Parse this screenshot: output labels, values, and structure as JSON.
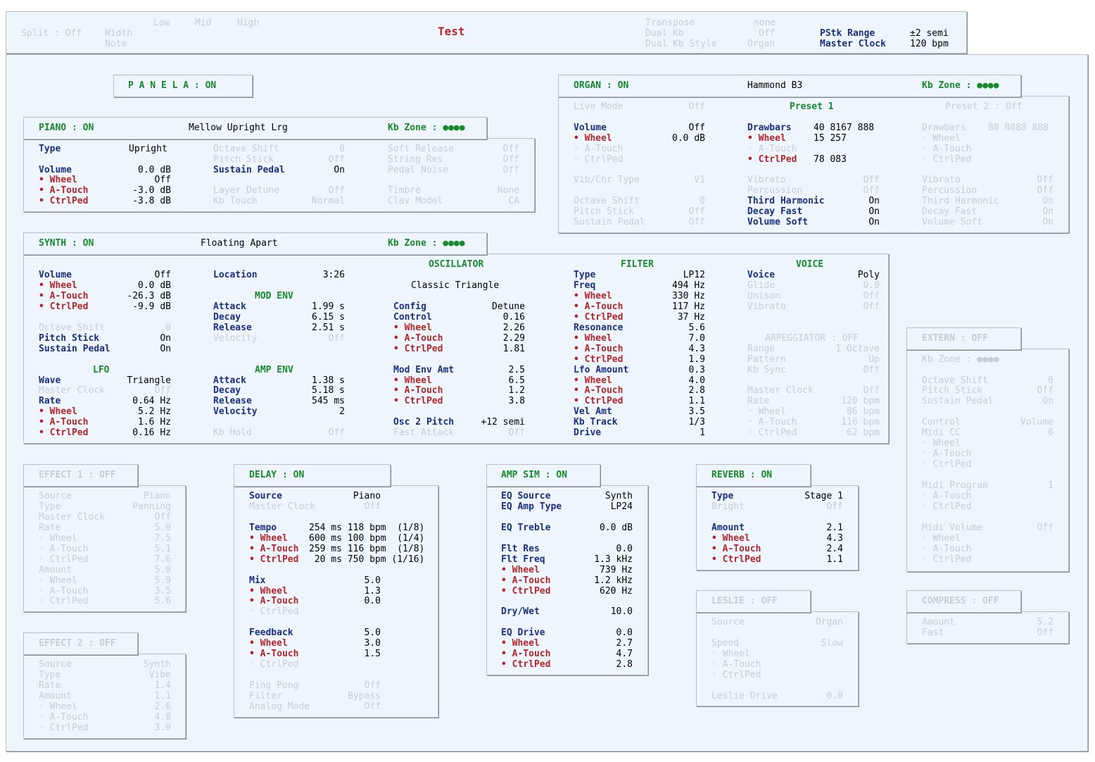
{
  "header": {
    "split": "Split : Off",
    "width_label": "Width",
    "note_label": "Note",
    "low": "Low",
    "mid": "Mid",
    "high": "High",
    "title": "Test",
    "transpose_label": "Transpose",
    "transpose_value": "none",
    "dual_kb_label": "Dual Kb",
    "dual_kb_value": "Off",
    "dual_kb_style_label": "Dual Kb Style",
    "dual_kb_style_value": "Organ",
    "pstk_label": "PStk Range",
    "pstk_value": "±2 semi",
    "master_clock_label": "Master Clock",
    "master_clock_value": "120 bpm"
  },
  "panel_a": "P A N E L  A : ON",
  "piano": {
    "tab": "PIANO : ON",
    "preset": "Mellow Upright Lrg",
    "kbzone": "Kb Zone : ●●●●",
    "type_l": "Type",
    "type_v": "Upright",
    "vol_l": "Volume",
    "vol_v": "0.0 dB",
    "wheel_l": "• Wheel",
    "wheel_v": "Off",
    "at_l": "• A-Touch",
    "at_v": "-3.0 dB",
    "cp_l": "• CtrlPed",
    "cp_v": "-3.8 dB",
    "oct_l": "Octave Shift",
    "oct_v": "0",
    "ps_l": "Pitch Stick",
    "ps_v": "Off",
    "sp_l": "Sustain Pedal",
    "sp_v": "On",
    "ld_l": "Layer Detune",
    "ld_v": "Off",
    "kt_l": "Kb Touch",
    "kt_v": "Normal",
    "sr_l": "Soft Release",
    "sr_v": "Off",
    "str_l": "String Res",
    "str_v": "Off",
    "pn_l": "Pedal Noise",
    "pn_v": "Off",
    "tim_l": "Timbre",
    "tim_v": "None",
    "clav_l": "Clav Model",
    "clav_v": "CA"
  },
  "organ": {
    "tab": "ORGAN : ON",
    "preset": "Hammond B3",
    "kbzone": "Kb Zone : ●●●●",
    "live_l": "Live Mode",
    "live_v": "Off",
    "preset1": "Preset 1",
    "preset2": "Preset 2 : Off",
    "vol_l": "Volume",
    "vol_v": "Off",
    "wheel_l": "• Wheel",
    "wheel_v": "0.0 dB",
    "at_l": "◦ A-Touch",
    "cp_l": "◦ CtrlPed",
    "vib_l": "Vib/Chr Type",
    "vib_v": "V1",
    "oct_l": "Octave Shift",
    "oct_v": "0",
    "ps_l": "Pitch Stick",
    "ps_v": "Off",
    "sp_l": "Sustain Pedal",
    "sp_v": "Off",
    "p1": {
      "db_l": "Drawbars",
      "db_v": "40 8167 888",
      "wheel_l": "• Wheel",
      "wheel_v": "15 257",
      "at_l": "◦ A-Touch",
      "cp_l": "• CtrlPed",
      "cp_v": "78 083",
      "vibrato_l": "Vibrato",
      "vibrato_v": "Off",
      "perc_l": "Percussion",
      "perc_v": "Off",
      "th_l": "Third Harmonic",
      "th_v": "On",
      "df_l": "Decay Fast",
      "df_v": "On",
      "vs_l": "Volume Soft",
      "vs_v": "On"
    },
    "p2": {
      "db_l": "Drawbars",
      "db_v": "88 8888 888",
      "wheel_l": "◦ Wheel",
      "at_l": "◦ A-Touch",
      "cp_l": "◦ CtrlPed",
      "vibrato_l": "Vibrato",
      "vibrato_v": "Off",
      "perc_l": "Percussion",
      "perc_v": "Off",
      "th_l": "Third Harmonic",
      "th_v": "On",
      "df_l": "Decay Fast",
      "df_v": "On",
      "vs_l": "Volume Soft",
      "vs_v": "On"
    }
  },
  "synth": {
    "tab": "SYNTH : ON",
    "preset": "Floating Apart",
    "kbzone": "Kb Zone : ●●●●",
    "vol_l": "Volume",
    "vol_v": "Off",
    "wheel_l": "• Wheel",
    "wheel_v": "0.0 dB",
    "at_l": "• A-Touch",
    "at_v": "-26.3 dB",
    "cp_l": "• CtrlPed",
    "cp_v": "-9.9 dB",
    "oct_l": "Octave Shift",
    "oct_v": "0",
    "ps_l": "Pitch Stick",
    "ps_v": "On",
    "sp_l": "Sustain Pedal",
    "sp_v": "On",
    "lfo_h": "LFO",
    "wave_l": "Wave",
    "wave_v": "Triangle",
    "mc_l": "Master Clock",
    "mc_v": "Off",
    "rate_l": "Rate",
    "rate_v": "0.64 Hz",
    "lw_l": "• Wheel",
    "lw_v": "5.2 Hz",
    "la_l": "• A-Touch",
    "la_v": "1.6 Hz",
    "lc_l": "• CtrlPed",
    "lc_v": "0.16 Hz",
    "loc_l": "Location",
    "loc_v": "3:26",
    "modenv_h": "MOD ENV",
    "ma_l": "Attack",
    "ma_v": "1.99 s",
    "md_l": "Decay",
    "md_v": "6.15 s",
    "mr_l": "Release",
    "mr_v": "2.51 s",
    "mv_l": "Velocity",
    "mv_v": "Off",
    "ampenv_h": "AMP ENV",
    "aa_l": "Attack",
    "aa_v": "1.38 s",
    "ad_l": "Decay",
    "ad_v": "5.18 s",
    "ar_l": "Release",
    "ar_v": "545 ms",
    "av_l": "Velocity",
    "av_v": "2",
    "kh_l": "Kb Hold",
    "kh_v": "Off",
    "osc_h": "OSCILLATOR",
    "osc_name": "Classic Triangle",
    "cfg_l": "Config",
    "cfg_v": "Detune",
    "ctl_l": "Control",
    "ctl_v": "0.16",
    "ow_l": "• Wheel",
    "ow_v": "2.26",
    "oa_l": "• A-Touch",
    "oa_v": "2.29",
    "oc_l": "• CtrlPed",
    "oc_v": "1.81",
    "mea_l": "Mod Env Amt",
    "mea_v": "2.5",
    "mew_l": "• Wheel",
    "mew_v": "6.5",
    "mea2_l": "• A-Touch",
    "mea2_v": "1.2",
    "mec_l": "• CtrlPed",
    "mec_v": "3.8",
    "o2p_l": "Osc 2 Pitch",
    "o2p_v": "+12 semi",
    "fa_l": "Fast Attack",
    "fa_v": "Off",
    "filt_h": "FILTER",
    "ft_l": "Type",
    "ft_v": "LP12",
    "ff_l": "Freq",
    "ff_v": "494 Hz",
    "ffw_l": "• Wheel",
    "ffw_v": "330 Hz",
    "ffa_l": "• A-Touch",
    "ffa_v": "117 Hz",
    "ffc_l": "• CtrlPed",
    "ffc_v": "37 Hz",
    "res_l": "Resonance",
    "res_v": "5.6",
    "rw_l": "• Wheel",
    "rw_v": "7.0",
    "ra_l": "• A-Touch",
    "ra_v": "4.3",
    "rc_l": "• CtrlPed",
    "rc_v": "1.9",
    "la2_l": "Lfo Amount",
    "la2_v": "0.3",
    "lfw_l": "• Wheel",
    "lfw_v": "4.0",
    "lfa_l": "• A-Touch",
    "lfa_v": "2.8",
    "lfc_l": "• CtrlPed",
    "lfc_v": "1.1",
    "vel_l": "Vel Amt",
    "vel_v": "3.5",
    "kbt_l": "Kb Track",
    "kbt_v": "1/3",
    "drv_l": "Drive",
    "drv_v": "1",
    "voice_h": "VOICE",
    "vo_l": "Voice",
    "vo_v": "Poly",
    "gl_l": "Glide",
    "gl_v": "0.0",
    "un_l": "Unison",
    "un_v": "Off",
    "vb_l": "Vibrato",
    "vb_v": "Off",
    "arp_h": "ARPEGGIATOR : OFF",
    "rg_l": "Range",
    "rg_v": "1 Octave",
    "pt_l": "Pattern",
    "pt_v": "Up",
    "ks_l": "Kb Sync",
    "ks_v": "Off",
    "amc_l": "Master Clock",
    "amc_v": "Off",
    "art_l": "Rate",
    "art_v": "120 bpm",
    "arw_l": "◦ Wheel",
    "arw_v": "86 bpm",
    "ara_l": "◦ A-Touch",
    "ara_v": "116 bpm",
    "arc_l": "◦ CtrlPed",
    "arc_v": "62 bpm"
  },
  "extern": {
    "tab": "EXTERN : OFF",
    "kbzone": "Kb Zone : ●●●●",
    "oct_l": "Octave Shift",
    "oct_v": "0",
    "ps_l": "Pitch Stick",
    "ps_v": "Off",
    "sp_l": "Sustain Pedal",
    "sp_v": "On",
    "ctl_l": "Control",
    "ctl_v": "Volume",
    "cc_l": "Midi CC",
    "cc_v": "0",
    "w1": "◦ Wheel",
    "a1": "◦ A-Touch",
    "c1": "◦ CtrlPed",
    "mp_l": "Midi Program",
    "mp_v": "1",
    "a2": "◦ A-Touch",
    "c2": "◦ CtrlPed",
    "mv_l": "Midi Volume",
    "mv_v": "Off",
    "w3": "◦ Wheel",
    "a3": "◦ A-Touch",
    "c3": "◦ CtrlPed"
  },
  "effect1": {
    "tab": "EFFECT 1 : OFF",
    "src_l": "Source",
    "src_v": "Piano",
    "type_l": "Type",
    "type_v": "Panning",
    "mc_l": "Master Clock",
    "mc_v": "Off",
    "rate_l": "Rate",
    "rate_v": "5.0",
    "rw_l": "◦ Wheel",
    "rw_v": "7.5",
    "ra_l": "◦ A-Touch",
    "ra_v": "5.1",
    "rc_l": "◦ CtrlPed",
    "rc_v": "7.6",
    "amt_l": "Amount",
    "amt_v": "5.0",
    "aw_l": "◦ Wheel",
    "aw_v": "5.9",
    "aa_l": "◦ A-Touch",
    "aa_v": "3.5",
    "ac_l": "◦ CtrlPed",
    "ac_v": "5.6"
  },
  "effect2": {
    "tab": "EFFECT 2 : OFF",
    "src_l": "Source",
    "src_v": "Synth",
    "type_l": "Type",
    "type_v": "Vibe",
    "rate_l": "Rate",
    "rate_v": "1.4",
    "amt_l": "Amount",
    "amt_v": "1.1",
    "aw_l": "◦ Wheel",
    "aw_v": "2.6",
    "aa_l": "◦ A-Touch",
    "aa_v": "4.8",
    "ac_l": "◦ CtrlPed",
    "ac_v": "3.0"
  },
  "delay": {
    "tab": "DELAY : ON",
    "src_l": "Source",
    "src_v": "Piano",
    "mc_l": "Master Clock",
    "mc_v": "Off",
    "tempo_l": "Tempo",
    "tempo_v": "254 ms 118 bpm  (1/8)",
    "tw_l": "• Wheel",
    "tw_v": "600 ms 100 bpm  (1/4)",
    "ta_l": "• A-Touch",
    "ta_v": "259 ms 116 bpm  (1/8)",
    "tc_l": "• CtrlPed",
    "tc_v": " 20 ms 750 bpm (1/16)",
    "mix_l": "Mix",
    "mix_v": "5.0",
    "mw_l": "• Wheel",
    "mw_v": "1.3",
    "ma_l": "• A-Touch",
    "ma_v": "0.0",
    "mc2_l": "◦ CtrlPed",
    "fb_l": "Feedback",
    "fb_v": "5.0",
    "fw_l": "• Wheel",
    "fw_v": "3.0",
    "fa_l": "• A-Touch",
    "fa_v": "1.5",
    "fc_l": "◦ CtrlPed",
    "pp_l": "Ping Pong",
    "pp_v": "Off",
    "fil_l": "Filter",
    "fil_v": "Bypass",
    "am_l": "Analog Mode",
    "am_v": "Off"
  },
  "ampsim": {
    "tab": "AMP SIM : ON",
    "eqs_l": "EQ Source",
    "eqs_v": "Synth",
    "eqa_l": "EQ Amp Type",
    "eqa_v": "LP24",
    "eqt_l": "EQ Treble",
    "eqt_v": "0.0 dB",
    "fr_l": "Flt Res",
    "fr_v": "0.0",
    "ff_l": "Flt Freq",
    "ff_v": "1.3 kHz",
    "fw_l": "• Wheel",
    "fw_v": "739 Hz",
    "fa_l": "• A-Touch",
    "fa_v": "1.2 kHz",
    "fc_l": "• CtrlPed",
    "fc_v": "620 Hz",
    "dw_l": "Dry/Wet",
    "dw_v": "10.0",
    "ed_l": "EQ Drive",
    "ed_v": "0.0",
    "ew_l": "• Wheel",
    "ew_v": "2.7",
    "ea_l": "• A-Touch",
    "ea_v": "4.7",
    "ec_l": "• CtrlPed",
    "ec_v": "2.8"
  },
  "reverb": {
    "tab": "REVERB : ON",
    "type_l": "Type",
    "type_v": "Stage 1",
    "br_l": "Bright",
    "br_v": "Off",
    "amt_l": "Amount",
    "amt_v": "2.1",
    "w_l": "• Wheel",
    "w_v": "4.3",
    "a_l": "• A-Touch",
    "a_v": "2.4",
    "c_l": "• CtrlPed",
    "c_v": "1.1"
  },
  "leslie": {
    "tab": "LESLIE : OFF",
    "src_l": "Source",
    "src_v": "Organ",
    "sp_l": "Speed",
    "sp_v": "Slow",
    "w_l": "◦ Wheel",
    "a_l": "◦ A-Touch",
    "c_l": "◦ CtrlPed",
    "ld_l": "Leslie Drive",
    "ld_v": "0.0"
  },
  "compress": {
    "tab": "COMPRESS : OFF",
    "amt_l": "Amount",
    "amt_v": "5.2",
    "fast_l": "Fast",
    "fast_v": "Off"
  }
}
